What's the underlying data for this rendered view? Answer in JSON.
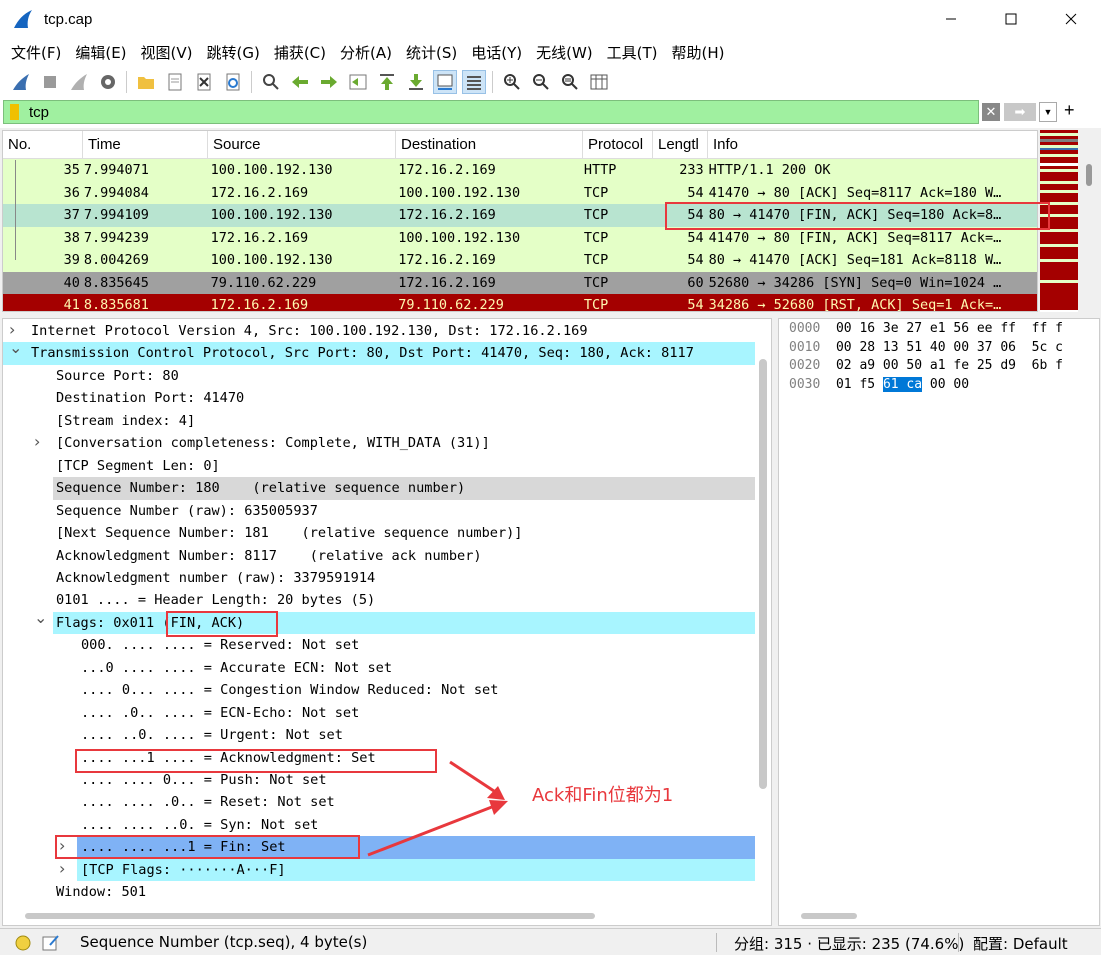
{
  "window": {
    "title": "tcp.cap"
  },
  "menu": [
    "文件(F)",
    "编辑(E)",
    "视图(V)",
    "跳转(G)",
    "捕获(C)",
    "分析(A)",
    "统计(S)",
    "电话(Y)",
    "无线(W)",
    "工具(T)",
    "帮助(H)"
  ],
  "filter": {
    "value": "tcp"
  },
  "columns": [
    "No.",
    "Time",
    "Source",
    "Destination",
    "Protocol",
    "Lengtl",
    "Info"
  ],
  "packets": [
    {
      "no": "35",
      "time": "7.994071",
      "src": "100.100.192.130",
      "dst": "172.16.2.169",
      "proto": "HTTP",
      "len": "233",
      "info": "HTTP/1.1 200 OK",
      "style": "green"
    },
    {
      "no": "36",
      "time": "7.994084",
      "src": "172.16.2.169",
      "dst": "100.100.192.130",
      "proto": "TCP",
      "len": "54",
      "info": "41470 → 80 [ACK] Seq=8117 Ack=180 W…",
      "style": "green"
    },
    {
      "no": "37",
      "time": "7.994109",
      "src": "100.100.192.130",
      "dst": "172.16.2.169",
      "proto": "TCP",
      "len": "54",
      "info": "80 → 41470 [FIN, ACK] Seq=180 Ack=8…",
      "style": "selected"
    },
    {
      "no": "38",
      "time": "7.994239",
      "src": "172.16.2.169",
      "dst": "100.100.192.130",
      "proto": "TCP",
      "len": "54",
      "info": "41470 → 80 [FIN, ACK] Seq=8117 Ack=…",
      "style": "green"
    },
    {
      "no": "39",
      "time": "8.004269",
      "src": "100.100.192.130",
      "dst": "172.16.2.169",
      "proto": "TCP",
      "len": "54",
      "info": "80 → 41470 [ACK] Seq=181 Ack=8118 W…",
      "style": "green"
    },
    {
      "no": "40",
      "time": "8.835645",
      "src": "79.110.62.229",
      "dst": "172.16.2.169",
      "proto": "TCP",
      "len": "60",
      "info": "52680 → 34286 [SYN] Seq=0 Win=1024 …",
      "style": "gray"
    },
    {
      "no": "41",
      "time": "8.835681",
      "src": "172.16.2.169",
      "dst": "79.110.62.229",
      "proto": "TCP",
      "len": "54",
      "info": "34286 → 52680 [RST, ACK] Seq=1 Ack=…",
      "style": "red"
    }
  ],
  "details": [
    {
      "text": "Internet Protocol Version 4, Src: 100.100.192.130, Dst: 172.16.2.169",
      "indent": 0,
      "arrow": "right",
      "style": ""
    },
    {
      "text": "Transmission Control Protocol, Src Port: 80, Dst Port: 41470, Seq: 180, Ack: 8117",
      "indent": 0,
      "arrow": "down",
      "style": "cyan"
    },
    {
      "text": "Source Port: 80",
      "indent": 1,
      "arrow": "",
      "style": ""
    },
    {
      "text": "Destination Port: 41470",
      "indent": 1,
      "arrow": "",
      "style": ""
    },
    {
      "text": "[Stream index: 4]",
      "indent": 1,
      "arrow": "",
      "style": ""
    },
    {
      "text": "[Conversation completeness: Complete, WITH_DATA (31)]",
      "indent": 1,
      "arrow": "right",
      "style": ""
    },
    {
      "text": "[TCP Segment Len: 0]",
      "indent": 1,
      "arrow": "",
      "style": ""
    },
    {
      "text": "Sequence Number: 180    (relative sequence number)",
      "indent": 1,
      "arrow": "",
      "style": "gray"
    },
    {
      "text": "Sequence Number (raw): 635005937",
      "indent": 1,
      "arrow": "",
      "style": ""
    },
    {
      "text": "[Next Sequence Number: 181    (relative sequence number)]",
      "indent": 1,
      "arrow": "",
      "style": ""
    },
    {
      "text": "Acknowledgment Number: 8117    (relative ack number)",
      "indent": 1,
      "arrow": "",
      "style": ""
    },
    {
      "text": "Acknowledgment number (raw): 3379591914",
      "indent": 1,
      "arrow": "",
      "style": ""
    },
    {
      "text": "0101 .... = Header Length: 20 bytes (5)",
      "indent": 1,
      "arrow": "",
      "style": ""
    },
    {
      "text": "Flags: 0x011 (FIN, ACK)",
      "indent": 1,
      "arrow": "down",
      "style": "cyan"
    },
    {
      "text": "000. .... .... = Reserved: Not set",
      "indent": 2,
      "arrow": "",
      "style": ""
    },
    {
      "text": "...0 .... .... = Accurate ECN: Not set",
      "indent": 2,
      "arrow": "",
      "style": ""
    },
    {
      "text": ".... 0... .... = Congestion Window Reduced: Not set",
      "indent": 2,
      "arrow": "",
      "style": ""
    },
    {
      "text": ".... .0.. .... = ECN-Echo: Not set",
      "indent": 2,
      "arrow": "",
      "style": ""
    },
    {
      "text": ".... ..0. .... = Urgent: Not set",
      "indent": 2,
      "arrow": "",
      "style": ""
    },
    {
      "text": ".... ...1 .... = Acknowledgment: Set",
      "indent": 2,
      "arrow": "",
      "style": ""
    },
    {
      "text": ".... .... 0... = Push: Not set",
      "indent": 2,
      "arrow": "",
      "style": ""
    },
    {
      "text": ".... .... .0.. = Reset: Not set",
      "indent": 2,
      "arrow": "",
      "style": ""
    },
    {
      "text": ".... .... ..0. = Syn: Not set",
      "indent": 2,
      "arrow": "",
      "style": ""
    },
    {
      "text": ".... .... ...1 = Fin: Set",
      "indent": 2,
      "arrow": "right",
      "style": "blue"
    },
    {
      "text": "[TCP Flags: ·······A···F]",
      "indent": 2,
      "arrow": "right",
      "style": "cyan"
    },
    {
      "text": "Window: 501",
      "indent": 1,
      "arrow": "",
      "style": ""
    }
  ],
  "hex": [
    {
      "offset": "0000",
      "bytes": "00 16 3e 27 e1 56 ee ff  ff f"
    },
    {
      "offset": "0010",
      "bytes": "00 28 13 51 40 00 37 06  5c c"
    },
    {
      "offset": "0020",
      "bytes": "02 a9 00 50 a1 fe 25 d9  6b f"
    },
    {
      "offset": "0030",
      "bytes_pre": "01 f5 ",
      "bytes_sel": "61 ca",
      "bytes_post": " 00 00"
    }
  ],
  "annotation": {
    "text": "Ack和Fin位都为1"
  },
  "status": {
    "field": "Sequence Number (tcp.seq), 4 byte(s)",
    "packets": "分组: 315 · 已显示: 235 (74.6%)",
    "profile": "配置: Default"
  },
  "colors": {
    "selected_row": "#b8e4d0",
    "green_row": "#e4ffc7",
    "red_row": "#a40000",
    "filter_bg": "#a0f0a0",
    "highlight": "#e8383d"
  }
}
